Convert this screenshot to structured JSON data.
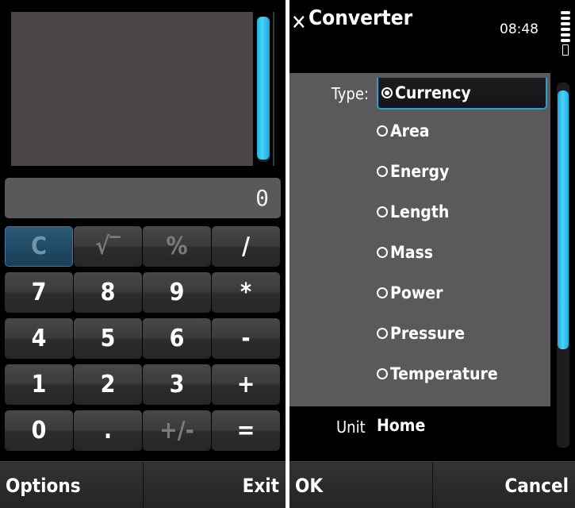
{
  "calculator": {
    "display_value": "0",
    "keys": [
      {
        "label": "C",
        "state": "active"
      },
      {
        "label": "√‾",
        "state": "disabled"
      },
      {
        "label": "%",
        "state": "disabled"
      },
      {
        "label": "/",
        "state": "normal"
      },
      {
        "label": "7",
        "state": "normal"
      },
      {
        "label": "8",
        "state": "normal"
      },
      {
        "label": "9",
        "state": "normal"
      },
      {
        "label": "*",
        "state": "normal"
      },
      {
        "label": "4",
        "state": "normal"
      },
      {
        "label": "5",
        "state": "normal"
      },
      {
        "label": "6",
        "state": "normal"
      },
      {
        "label": "-",
        "state": "normal"
      },
      {
        "label": "1",
        "state": "normal"
      },
      {
        "label": "2",
        "state": "normal"
      },
      {
        "label": "3",
        "state": "normal"
      },
      {
        "label": "+",
        "state": "normal"
      },
      {
        "label": "0",
        "state": "normal"
      },
      {
        "label": ".",
        "state": "normal"
      },
      {
        "label": "+/-",
        "state": "disabled"
      },
      {
        "label": "=",
        "state": "normal"
      }
    ],
    "softkeys": {
      "left": "Options",
      "right": "Exit"
    }
  },
  "converter": {
    "title": "Converter",
    "close_icon": "close-x-icon",
    "status": {
      "time": "08:48",
      "signal_bars": 6,
      "battery": "battery-icon"
    },
    "type_label": "Type:",
    "options": [
      {
        "label": "Currency",
        "selected": true
      },
      {
        "label": "Area",
        "selected": false
      },
      {
        "label": "Energy",
        "selected": false
      },
      {
        "label": "Length",
        "selected": false
      },
      {
        "label": "Mass",
        "selected": false
      },
      {
        "label": "Power",
        "selected": false
      },
      {
        "label": "Pressure",
        "selected": false
      },
      {
        "label": "Temperature",
        "selected": false
      }
    ],
    "unit_label": "Unit",
    "unit_value": "Home",
    "softkeys": {
      "left": "OK",
      "right": "Cancel"
    }
  },
  "colors": {
    "accent": "#26a3d4",
    "scrollbar": "#1ab6e6",
    "panel": "#5c595c"
  }
}
